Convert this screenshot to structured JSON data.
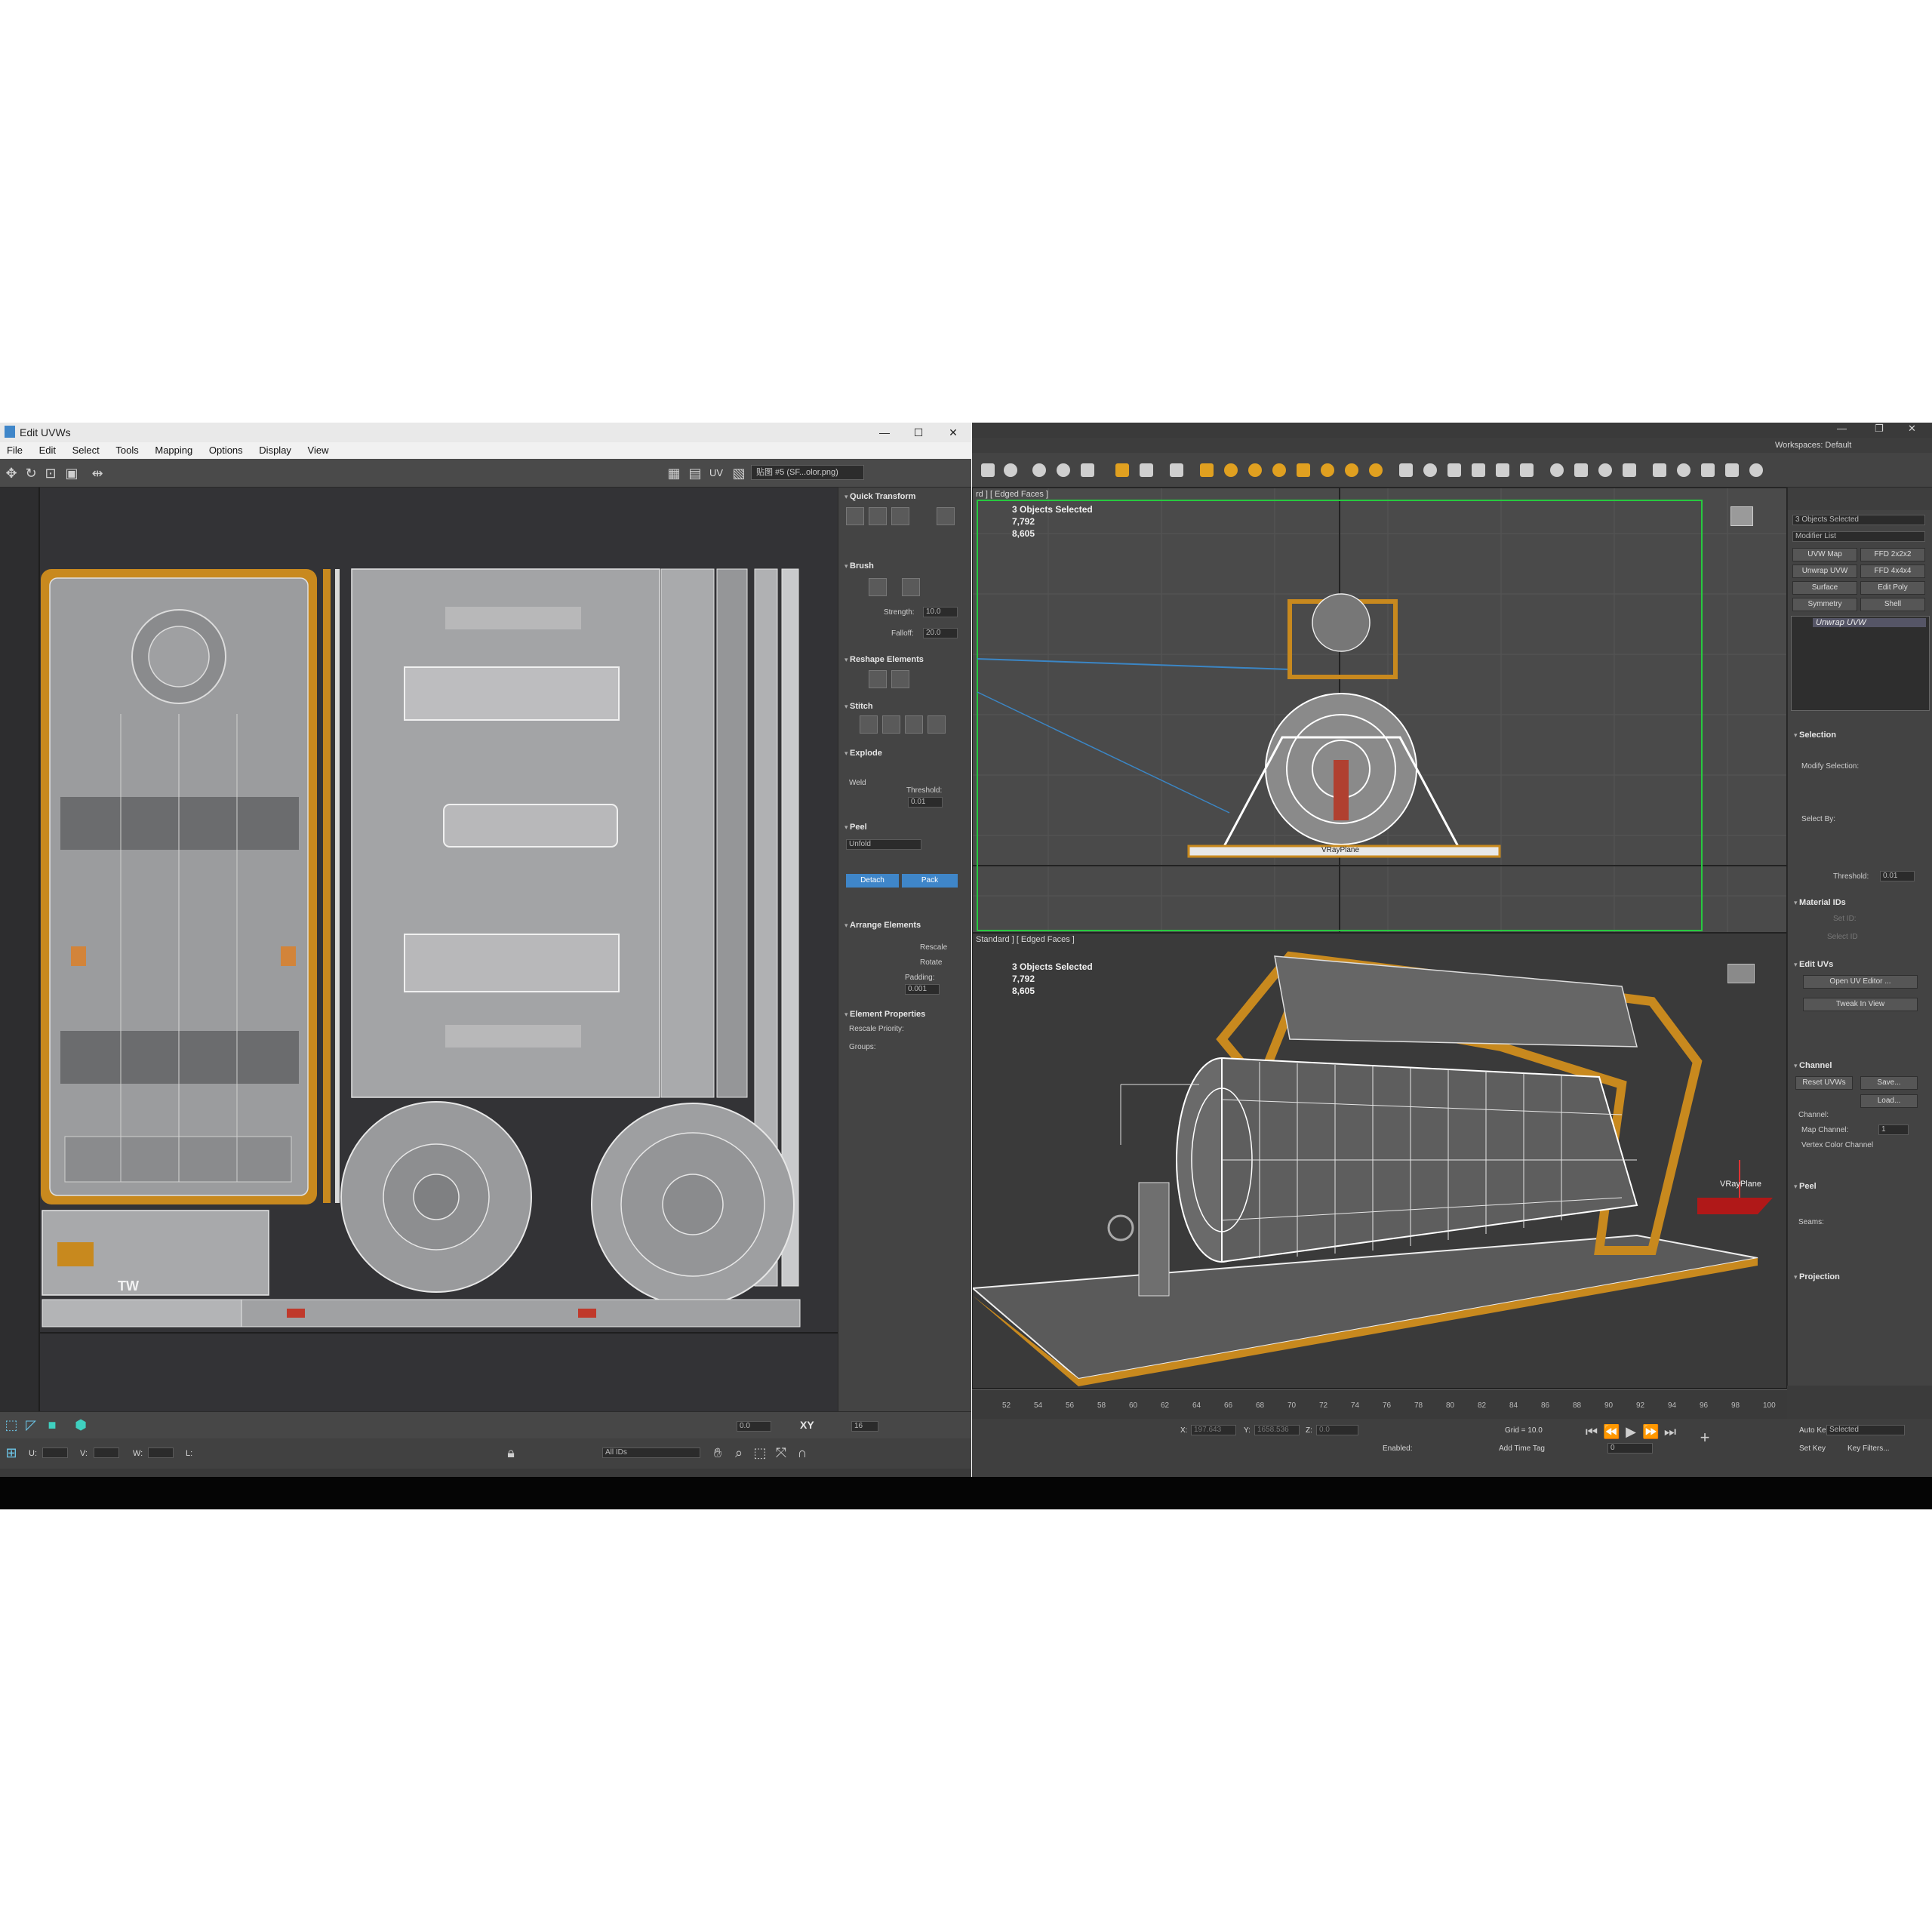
{
  "uvw_window": {
    "title": "Edit UVWs",
    "window_buttons": [
      "—",
      "☐",
      "✕"
    ],
    "menu": [
      "File",
      "Edit",
      "Select",
      "Tools",
      "Mapping",
      "Options",
      "Display",
      "View"
    ],
    "toolbar": {
      "uv_label": "UV",
      "map_selector": "贴图 #5 (SF...olor.png)"
    },
    "rollouts": {
      "quick_transform": "Quick Transform",
      "brush": "Brush",
      "strength_label": "Strength:",
      "strength_value": "10.0",
      "falloff_label": "Falloff:",
      "falloff_value": "20.0",
      "reshape": "Reshape Elements",
      "stitch": "Stitch",
      "explode": "Explode",
      "weld": "Weld",
      "threshold_label": "Threshold:",
      "threshold_value": "0.01",
      "peel": "Peel",
      "unfold": "Unfold",
      "detach": "Detach",
      "pack": "Pack",
      "arrange": "Arrange Elements",
      "rescale": "Rescale",
      "rotate": "Rotate",
      "padding_label": "Padding:",
      "padding_value": "0.001",
      "element_props": "Element Properties",
      "rescale_priority": "Rescale Priority:",
      "groups": "Groups:"
    },
    "texture_text": "TW",
    "bottom_bar": {
      "spin_value": "0.0",
      "xy_label": "XY",
      "grid_value": "16",
      "u_label": "U:",
      "v_label": "V:",
      "w_label": "W:",
      "l_label": "L:",
      "ids_dropdown": "All IDs"
    }
  },
  "max_window": {
    "window_buttons": [
      "—",
      "❐",
      "✕"
    ],
    "workspace_label": "Workspaces: Default",
    "viewport_top": {
      "label": "rd ] [ Edged Faces ]",
      "selected": "3 Objects Selected",
      "stat1": "7,792",
      "stat2": "8,605",
      "object_label": "VRayPlane"
    },
    "viewport_persp": {
      "label": "Standard ] [ Edged Faces ]",
      "selected": "3 Objects Selected",
      "stat1": "7,792",
      "stat2": "8,605",
      "object_label": "VRayPlane"
    },
    "command_panel": {
      "selection_count": "3 Objects Selected",
      "modifier_list": "Modifier List",
      "modifier_buttons": [
        "UVW Map",
        "FFD 2x2x2",
        "Unwrap UVW",
        "FFD 4x4x4",
        "Surface",
        "Edit Poly",
        "Symmetry",
        "Shell"
      ],
      "stack_item": "Unwrap UVW",
      "selection": "Selection",
      "modify_selection": "Modify Selection:",
      "select_by": "Select By:",
      "threshold_label": "Threshold:",
      "threshold_value": "0.01",
      "material_ids": "Material IDs",
      "set_id": "Set ID:",
      "select_id": "Select ID",
      "edit_uvs": "Edit UVs",
      "open_uv_editor": "Open UV Editor ...",
      "tweak_in_view": "Tweak In View",
      "channel": "Channel",
      "reset_uvws": "Reset UVWs",
      "save": "Save...",
      "load": "Load...",
      "channel_label": "Channel:",
      "map_channel": "Map Channel:",
      "map_channel_value": "1",
      "vertex_color": "Vertex Color Channel",
      "peel": "Peel",
      "seams": "Seams:",
      "projection": "Projection"
    },
    "timeline_ticks": [
      "52",
      "54",
      "56",
      "58",
      "60",
      "62",
      "64",
      "66",
      "68",
      "70",
      "72",
      "74",
      "76",
      "78",
      "80",
      "82",
      "84",
      "86",
      "88",
      "90",
      "92",
      "94",
      "96",
      "98",
      "100"
    ],
    "status": {
      "x_label": "X:",
      "x_value": "197.643",
      "y_label": "Y:",
      "y_value": "1658.536",
      "z_label": "Z:",
      "z_value": "0.0",
      "grid": "Grid = 10.0",
      "enabled": "Enabled:",
      "add_time_tag": "Add Time Tag",
      "auto_key": "Auto Key",
      "selected": "Selected",
      "set_key": "Set Key",
      "key_filters": "Key Filters...",
      "frame": "0"
    }
  },
  "colors": {
    "accent_blue": "#3f86c9",
    "frame_orange": "#c8891e",
    "viewport_bg": "#4a4a4a",
    "panel_bg": "#444444"
  }
}
